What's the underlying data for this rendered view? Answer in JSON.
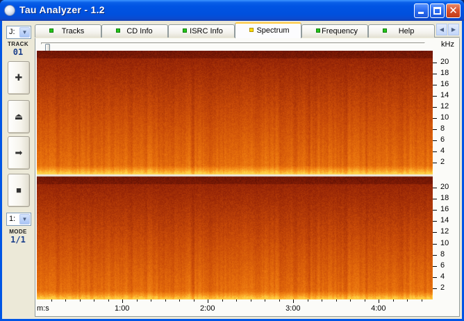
{
  "window": {
    "title": "Tau Analyzer - 1.2"
  },
  "titlebar_buttons": {
    "minimize_icon": "minimize-icon",
    "maximize_icon": "maximize-icon",
    "close_glyph": "✕"
  },
  "sidebar": {
    "drive_select": {
      "value": "J:"
    },
    "track_caption": "TRACK",
    "track_value": "01",
    "buttons": [
      {
        "name": "add-button",
        "icon": "plus-icon",
        "glyph": "✚"
      },
      {
        "name": "eject-button",
        "icon": "eject-icon",
        "glyph": "⏏"
      },
      {
        "name": "play-button",
        "icon": "arrow-right-icon",
        "glyph": "➡"
      },
      {
        "name": "stop-button",
        "icon": "stop-icon",
        "glyph": "■"
      }
    ],
    "mode_select": {
      "value": "1:"
    },
    "mode_caption": "MODE",
    "mode_value": "1/1"
  },
  "tabs": [
    {
      "label": "Tracks",
      "active": false
    },
    {
      "label": "CD Info",
      "active": false
    },
    {
      "label": "ISRC Info",
      "active": false
    },
    {
      "label": "Spectrum",
      "active": true
    },
    {
      "label": "Frequency",
      "active": false
    },
    {
      "label": "Help",
      "active": false
    }
  ],
  "spectrum": {
    "unit_label": "kHz",
    "channels": 2,
    "freq_ticks": [
      "20",
      "18",
      "16",
      "14",
      "12",
      "10",
      "8",
      "6",
      "4",
      "2"
    ],
    "freq_values": [
      20,
      18,
      16,
      14,
      12,
      10,
      8,
      6,
      4,
      2
    ],
    "freq_max": 22.05,
    "time_axis_label": "m:s",
    "time_ticks": [
      "1:00",
      "2:00",
      "3:00",
      "4:00"
    ],
    "time_values_s": [
      60,
      120,
      180,
      240
    ],
    "duration_s": 278,
    "palette": {
      "dark": "#6b1a08",
      "mid": "#c84a08",
      "bright": "#f08010",
      "hot": "#ffd040"
    },
    "seek_position": 0.0
  }
}
